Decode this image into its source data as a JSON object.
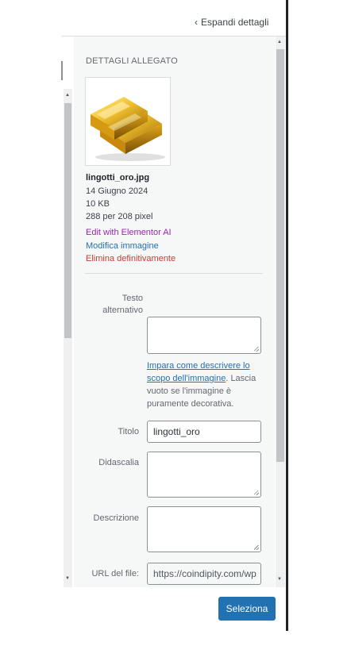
{
  "header": {
    "expand_label": "Espandi dettagli"
  },
  "details": {
    "section_title": "DETTAGLI ALLEGATO",
    "filename": "lingotti_oro.jpg",
    "date": "14 Giugno 2024",
    "size": "10 KB",
    "dimensions": "288 per 208 pixel",
    "actions": {
      "elementor_ai": "Edit with Elementor AI",
      "edit_image": "Modifica immagine",
      "delete": "Elimina definitivamente"
    }
  },
  "form": {
    "alt_label_1": "Testo",
    "alt_label_2": "alternativo",
    "alt_value": "",
    "help_link_1": "Impara come descrivere lo",
    "help_link_2": "scopo dell'immagine",
    "help_text_1": ". Lascia",
    "help_text_2": "vuoto se l'immagine è",
    "help_text_3": "puramente decorativa.",
    "title_label": "Titolo",
    "title_value": "lingotti_oro",
    "caption_label": "Didascalia",
    "caption_value": "",
    "description_label": "Descrizione",
    "description_value": "",
    "url_label": "URL del file:",
    "url_value": "https://coindipity.com/wp"
  },
  "footer": {
    "select_label": "Seleziona"
  },
  "colors": {
    "primary": "#2271b1",
    "elementor": "#9c27b0",
    "danger": "#d63638"
  }
}
